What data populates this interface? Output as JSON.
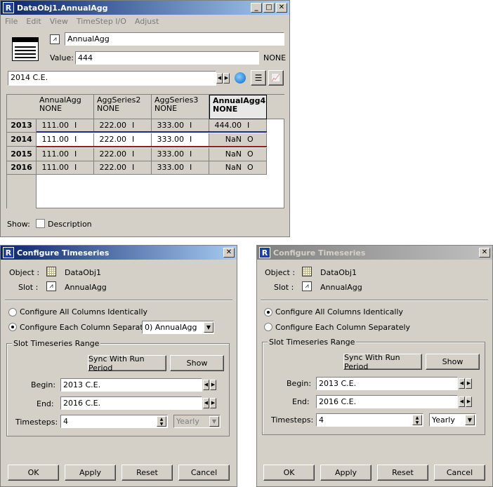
{
  "main": {
    "title": "DataObj1.AnnualAgg",
    "menu": [
      "File",
      "Edit",
      "View",
      "TimeStep I/O",
      "Adjust"
    ],
    "slot_name": "AnnualAgg",
    "value_label": "Value:",
    "value": "444",
    "units": "NONE",
    "timestep": "2014 C.E.",
    "columns": [
      {
        "name": "AnnualAgg",
        "units": "NONE"
      },
      {
        "name": "AggSeries2",
        "units": "NONE"
      },
      {
        "name": "AggSeries3",
        "units": "NONE"
      },
      {
        "name": "AnnualAgg4",
        "units": "NONE"
      }
    ],
    "rows": [
      {
        "year": "2013",
        "cells": [
          [
            "111.00",
            "I"
          ],
          [
            "222.00",
            "I"
          ],
          [
            "333.00",
            "I"
          ],
          [
            "444.00",
            "I"
          ]
        ]
      },
      {
        "year": "2014",
        "cells": [
          [
            "111.00",
            "I"
          ],
          [
            "222.00",
            "I"
          ],
          [
            "333.00",
            "I"
          ],
          [
            "NaN",
            "O"
          ]
        ]
      },
      {
        "year": "2015",
        "cells": [
          [
            "111.00",
            "I"
          ],
          [
            "222.00",
            "I"
          ],
          [
            "333.00",
            "I"
          ],
          [
            "NaN",
            "O"
          ]
        ]
      },
      {
        "year": "2016",
        "cells": [
          [
            "111.00",
            "I"
          ],
          [
            "222.00",
            "I"
          ],
          [
            "333.00",
            "I"
          ],
          [
            "NaN",
            "O"
          ]
        ]
      }
    ],
    "show_label": "Show:",
    "description_label": "Description"
  },
  "dialog_left": {
    "title": "Configure Timeseries",
    "object_label": "Object :",
    "object_value": "DataObj1",
    "slot_label": "Slot :",
    "slot_value": "AnnualAgg",
    "radio_all": "Configure All Columns Identically",
    "radio_each": "Configure Each Column Separately",
    "column_select": "0)  AnnualAgg",
    "group_label": "Slot Timeseries Range",
    "sync_button": "Sync With Run Period",
    "show_button": "Show",
    "begin_label": "Begin:",
    "begin_value": "2013 C.E.",
    "end_label": "End:",
    "end_value": "2016 C.E.",
    "timesteps_label": "Timesteps:",
    "timesteps_value": "4",
    "interval": "Yearly",
    "ok": "OK",
    "apply": "Apply",
    "reset": "Reset",
    "cancel": "Cancel"
  },
  "dialog_right": {
    "title": "Configure Timeseries",
    "object_label": "Object :",
    "object_value": "DataObj1",
    "slot_label": "Slot :",
    "slot_value": "AnnualAgg",
    "radio_all": "Configure All Columns Identically",
    "radio_each": "Configure Each Column Separately",
    "group_label": "Slot Timeseries Range",
    "sync_button": "Sync With Run Period",
    "show_button": "Show",
    "begin_label": "Begin:",
    "begin_value": "2013 C.E.",
    "end_label": "End:",
    "end_value": "2016 C.E.",
    "timesteps_label": "Timesteps:",
    "timesteps_value": "4",
    "interval": "Yearly",
    "ok": "OK",
    "apply": "Apply",
    "reset": "Reset",
    "cancel": "Cancel"
  }
}
